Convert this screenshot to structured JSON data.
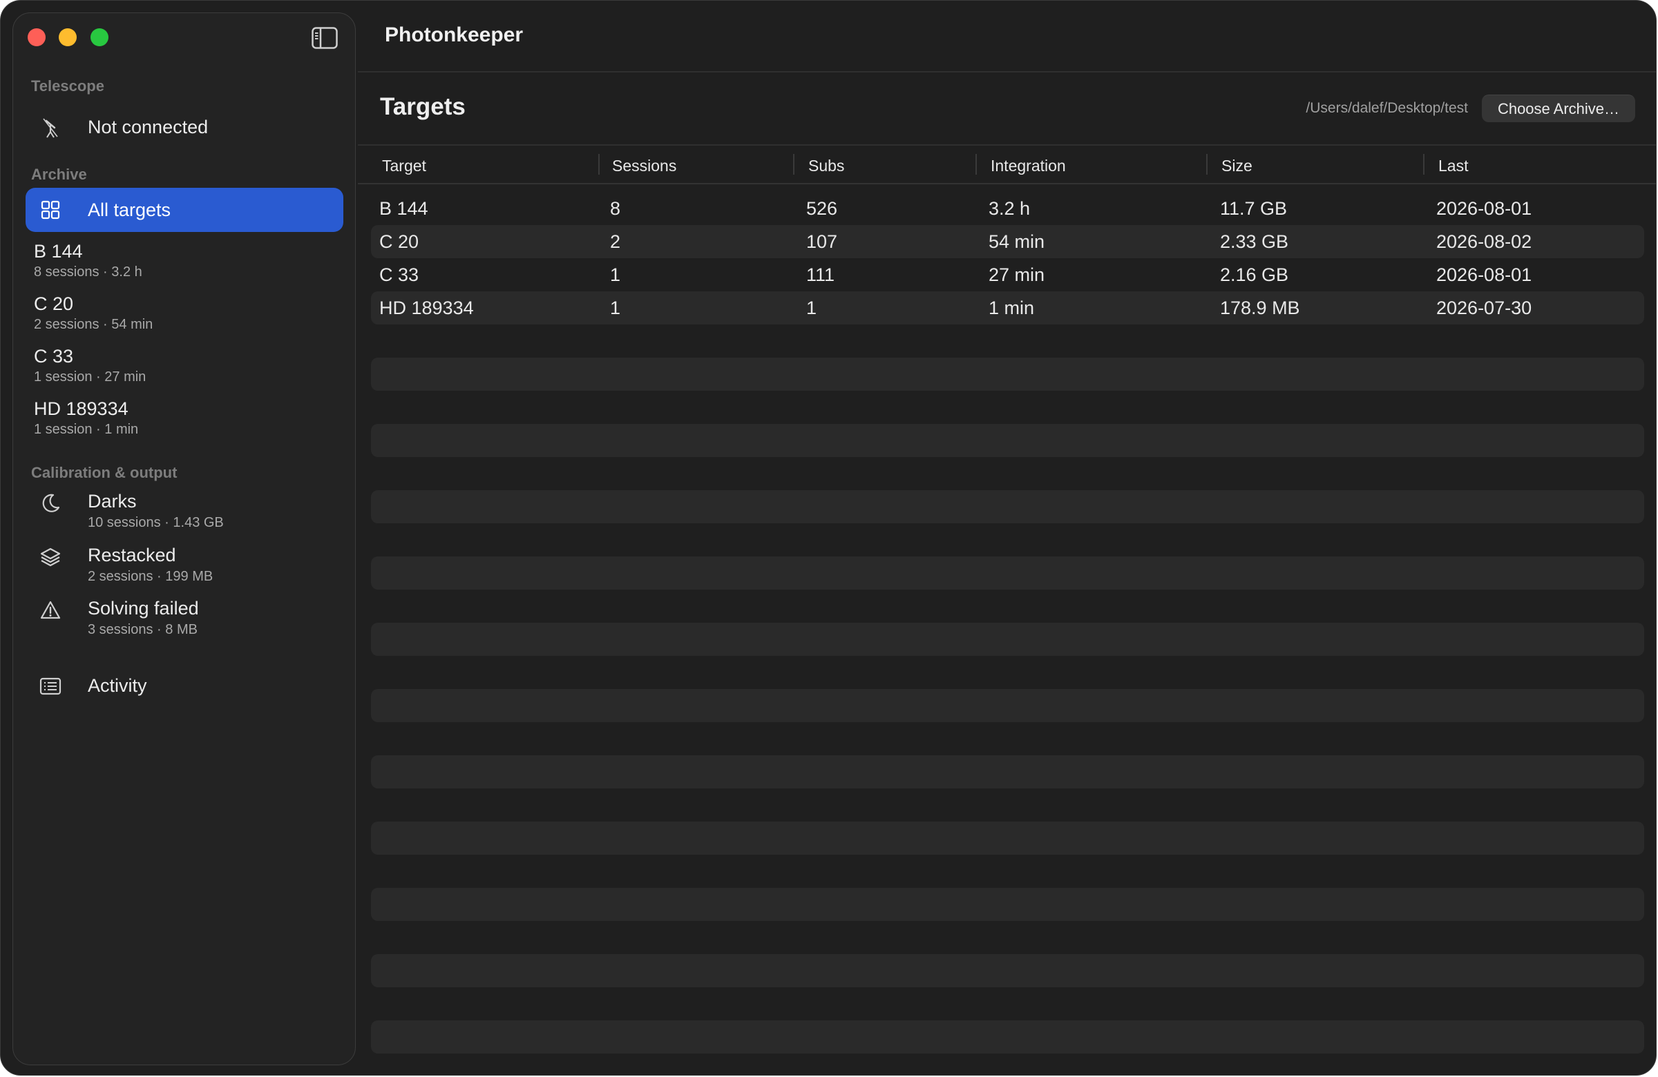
{
  "app": {
    "title": "Photonkeeper"
  },
  "sidebar": {
    "telescope_label": "Telescope",
    "telescope_status": "Not connected",
    "archive_label": "Archive",
    "all_targets": "All targets",
    "targets": [
      {
        "name": "B 144",
        "detail": "8 sessions · 3.2 h"
      },
      {
        "name": "C 20",
        "detail": "2 sessions · 54 min"
      },
      {
        "name": "C 33",
        "detail": "1 session · 27 min"
      },
      {
        "name": "HD 189334",
        "detail": "1 session · 1 min"
      }
    ],
    "calibration_label": "Calibration & output",
    "calibration": [
      {
        "name": "Darks",
        "detail": "10 sessions · 1.43 GB",
        "icon": "moon-icon"
      },
      {
        "name": "Restacked",
        "detail": "2 sessions · 199 MB",
        "icon": "layers-icon"
      },
      {
        "name": "Solving failed",
        "detail": "3 sessions · 8 MB",
        "icon": "warning-icon"
      }
    ],
    "activity": "Activity"
  },
  "main": {
    "title": "Targets",
    "archive_path": "/Users/dalef/Desktop/test",
    "choose_archive": "Choose Archive…",
    "columns": [
      "Target",
      "Sessions",
      "Subs",
      "Integration",
      "Size",
      "Last"
    ],
    "rows": [
      [
        "B 144",
        "8",
        "526",
        "3.2 h",
        "11.7 GB",
        "2026-08-01"
      ],
      [
        "C 20",
        "2",
        "107",
        "54 min",
        "2.33 GB",
        "2026-08-02"
      ],
      [
        "C 33",
        "1",
        "111",
        "27 min",
        "2.16 GB",
        "2026-08-01"
      ],
      [
        "HD 189334",
        "1",
        "1",
        "1 min",
        "178.9 MB",
        "2026-07-30"
      ]
    ]
  },
  "colors": {
    "accent": "#2a5bd1",
    "window_bg": "#1f1f1f",
    "sidebar_bg": "#232323",
    "row_alt": "#2a2a2a"
  }
}
